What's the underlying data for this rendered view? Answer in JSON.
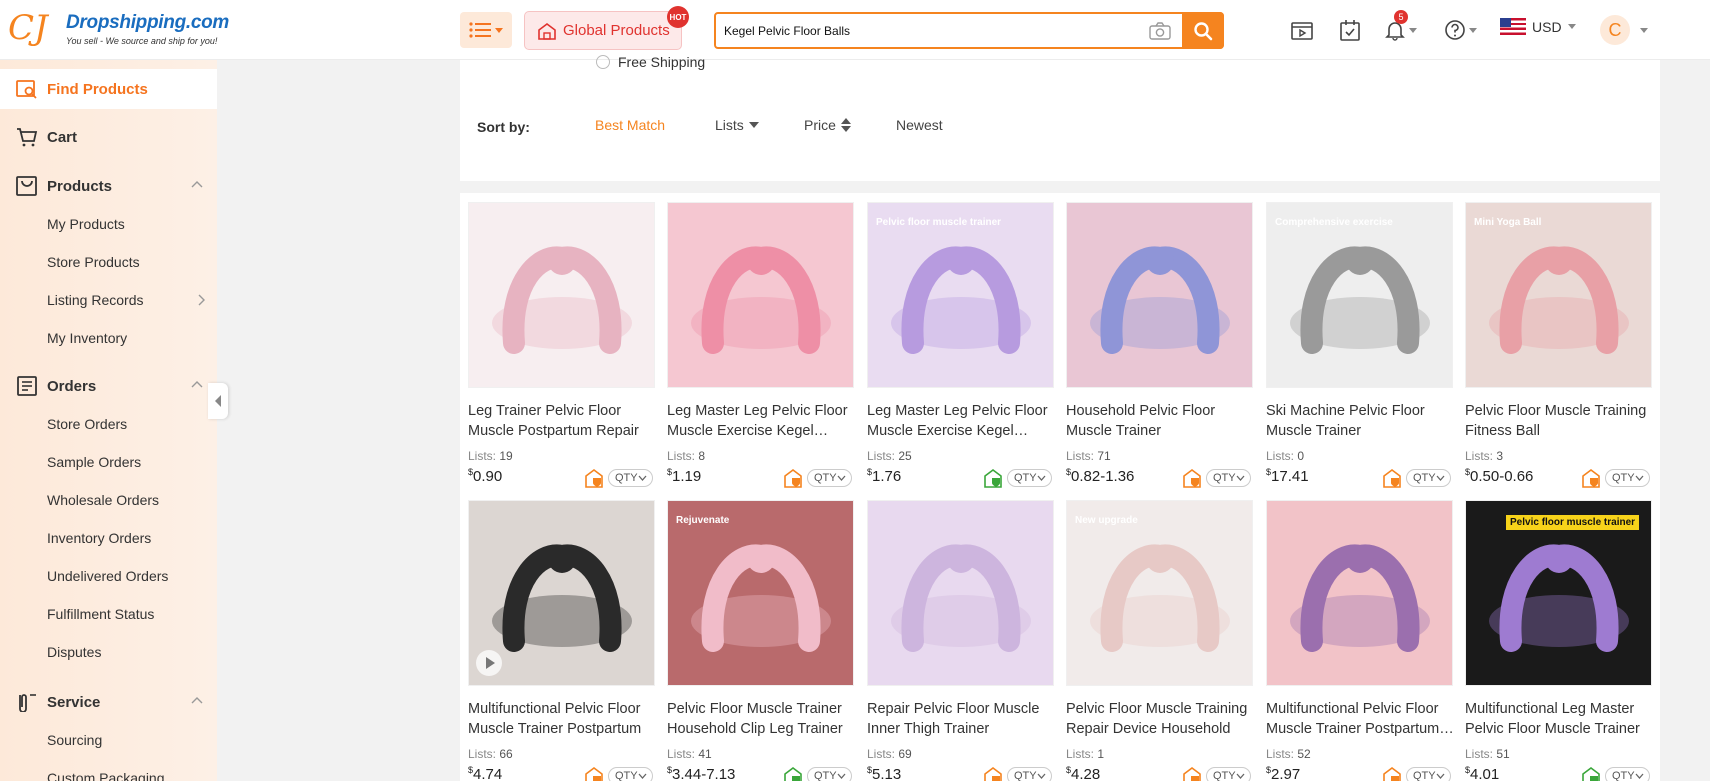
{
  "header": {
    "logo_mark": "CJ",
    "logo_name": "Dropshipping.com",
    "logo_tagline": "You sell - We source and ship for you!",
    "global_products_label": "Global Products",
    "hot_badge": "HOT",
    "search_value": "Kegel Pelvic Floor Balls",
    "notification_count": "5",
    "currency": "USD",
    "avatar_initial": "C"
  },
  "sidebar": {
    "find_products": "Find Products",
    "cart": "Cart",
    "products": "Products",
    "products_items": [
      "My Products",
      "Store Products",
      "Listing Records",
      "My Inventory"
    ],
    "orders": "Orders",
    "orders_items": [
      "Store Orders",
      "Sample Orders",
      "Wholesale Orders",
      "Inventory Orders",
      "Undelivered Orders",
      "Fulfillment Status",
      "Disputes"
    ],
    "service": "Service",
    "service_items": [
      "Sourcing",
      "Custom Packaging"
    ]
  },
  "filters": {
    "free_shipping": "Free Shipping",
    "sort_by_label": "Sort by:",
    "sort_options": [
      "Best Match",
      "Lists",
      "Price",
      "Newest"
    ]
  },
  "products": [
    {
      "title": "Leg Trainer Pelvic Floor Muscle Postpartum Repair",
      "lists_label": "Lists:",
      "lists": "19",
      "currency_symbol": "$",
      "price": "0.90",
      "qty_label": "QTY",
      "shield_color": "#f5841f",
      "img_bg": "#f7eef0",
      "img_fg": "#e7b3c1"
    },
    {
      "title": "Leg Master Leg Pelvic Floor Muscle Exercise Kegel Trainer",
      "lists_label": "Lists:",
      "lists": "8",
      "currency_symbol": "$",
      "price": "1.19",
      "qty_label": "QTY",
      "shield_color": "#f5841f",
      "img_bg": "#f5c7d1",
      "img_fg": "#ee8fa6"
    },
    {
      "title": "Leg Master Leg Pelvic Floor Muscle Exercise Kegel Trainer",
      "lists_label": "Lists:",
      "lists": "25",
      "currency_symbol": "$",
      "price": "1.76",
      "qty_label": "QTY",
      "shield_color": "#3aa63a",
      "img_bg": "#e9dcf1",
      "img_fg": "#b79bdf",
      "overlay": "Pelvic floor muscle trainer"
    },
    {
      "title": "Household Pelvic Floor Muscle Trainer",
      "lists_label": "Lists:",
      "lists": "71",
      "currency_symbol": "$",
      "price": "0.82-1.36",
      "qty_label": "QTY",
      "shield_color": "#f5841f",
      "img_bg": "#e9c6d4",
      "img_fg": "#8f95d7"
    },
    {
      "title": "Ski Machine Pelvic Floor Muscle Trainer",
      "lists_label": "Lists:",
      "lists": "0",
      "currency_symbol": "$",
      "price": "17.41",
      "qty_label": "QTY",
      "shield_color": "#f5841f",
      "img_bg": "#eeeeee",
      "img_fg": "#9a9a9a",
      "overlay": "Comprehensive exercise"
    },
    {
      "title": "Pelvic Floor Muscle Training Fitness Ball",
      "lists_label": "Lists:",
      "lists": "3",
      "currency_symbol": "$",
      "price": "0.50-0.66",
      "qty_label": "QTY",
      "shield_color": "#f5841f",
      "img_bg": "#ead9d5",
      "img_fg": "#e8a0a6",
      "overlay": "Mini Yoga Ball"
    },
    {
      "title": "Multifunctional Pelvic Floor Muscle Trainer Postpartum",
      "lists_label": "Lists:",
      "lists": "66",
      "currency_symbol": "$",
      "price": "4.74",
      "qty_label": "QTY",
      "shield_color": "#f5841f",
      "img_bg": "#dcd6d2",
      "img_fg": "#2a2a2a"
    },
    {
      "title": "Pelvic Floor Muscle Trainer Household Clip Leg Trainer",
      "lists_label": "Lists:",
      "lists": "41",
      "currency_symbol": "$",
      "price": "3.44-7.13",
      "qty_label": "QTY",
      "shield_color": "#3aa63a",
      "img_bg": "#b96a6c",
      "img_fg": "#f1bcc9",
      "overlay": "Rejuvenate"
    },
    {
      "title": "Repair Pelvic Floor Muscle Inner Thigh Trainer",
      "lists_label": "Lists:",
      "lists": "69",
      "currency_symbol": "$",
      "price": "5.13",
      "qty_label": "QTY",
      "shield_color": "#f5841f",
      "img_bg": "#e8d9ef",
      "img_fg": "#cdb5de"
    },
    {
      "title": "Pelvic Floor Muscle Training Repair Device Household",
      "lists_label": "Lists:",
      "lists": "1",
      "currency_symbol": "$",
      "price": "4.28",
      "qty_label": "QTY",
      "shield_color": "#f5841f",
      "img_bg": "#f1ebea",
      "img_fg": "#e7c9c6",
      "overlay": "New upgrade"
    },
    {
      "title": "Multifunctional Pelvic Floor Muscle Trainer Postpartum Repair",
      "lists_label": "Lists:",
      "lists": "52",
      "currency_symbol": "$",
      "price": "2.97",
      "qty_label": "QTY",
      "shield_color": "#f5841f",
      "img_bg": "#f2c3c8",
      "img_fg": "#9b6fae"
    },
    {
      "title": "Multifunctional Leg Master Pelvic Floor Muscle Trainer",
      "lists_label": "Lists:",
      "lists": "51",
      "currency_symbol": "$",
      "price": "4.01",
      "qty_label": "QTY",
      "shield_color": "#3aa63a",
      "img_bg": "#1a1a1a",
      "img_fg": "#9e7bd1",
      "overlay": "Pelvic floor muscle trainer"
    }
  ],
  "colors": {
    "accent": "#f5841f",
    "brand_blue": "#1a6dbf",
    "hot_red": "#e0332f"
  }
}
